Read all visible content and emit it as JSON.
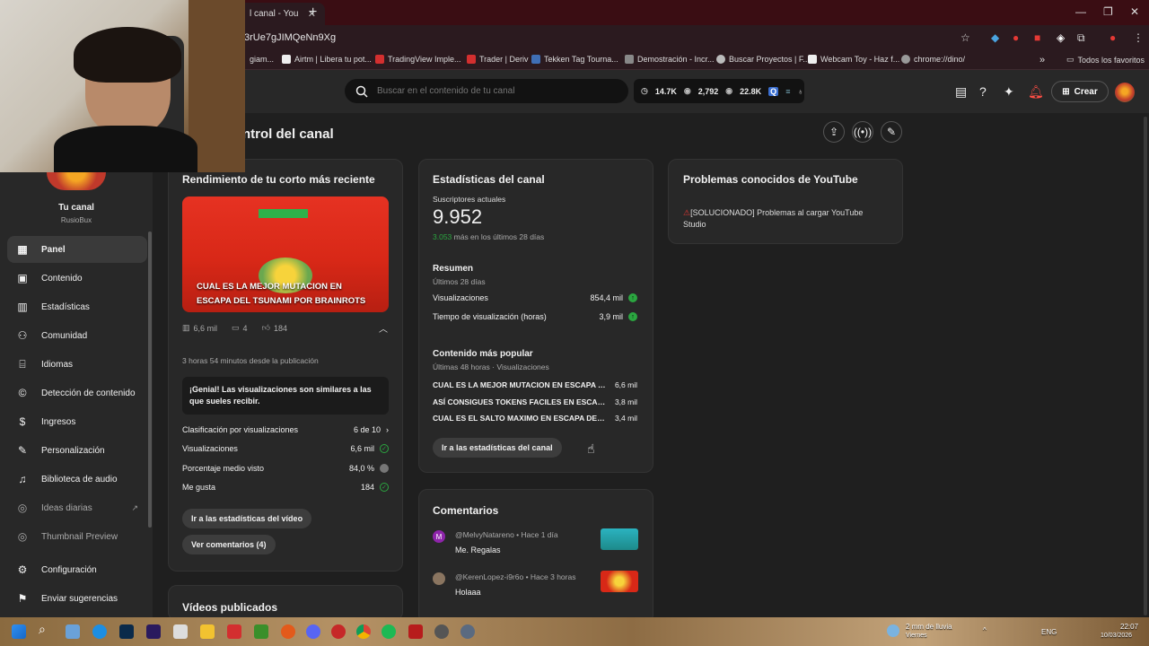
{
  "browser": {
    "tab_title": "l canal - You",
    "tab_close": "✕",
    "new_tab": "+",
    "url": "3rUe7gJIMQeNn9Xg",
    "bookmarks": [
      {
        "label": "giam..."
      },
      {
        "label": "Airtm | Libera tu pot..."
      },
      {
        "label": "TradingView Imple..."
      },
      {
        "label": "Trader | Deriv"
      },
      {
        "label": "Tekken Tag Tourna..."
      },
      {
        "label": "Demostración - Incr..."
      },
      {
        "label": "Buscar Proyectos | F..."
      },
      {
        "label": "Webcam Toy - Haz f..."
      },
      {
        "label": "chrome://dino/"
      }
    ],
    "all_bookmarks": "Todos los favoritos",
    "more_bookmarks": "»"
  },
  "header": {
    "search_placeholder": "Buscar en el contenido de tu canal",
    "stat1": "14.7K",
    "stat2": "2,792",
    "stat3": "22.8K",
    "create_label": "Crear"
  },
  "sidebar": {
    "channel_name": "Tu canal",
    "channel_handle": "RusioBux",
    "items": [
      {
        "label": "Panel"
      },
      {
        "label": "Contenido"
      },
      {
        "label": "Estadísticas"
      },
      {
        "label": "Comunidad"
      },
      {
        "label": "Idiomas"
      },
      {
        "label": "Detección de contenido"
      },
      {
        "label": "Ingresos"
      },
      {
        "label": "Personalización"
      },
      {
        "label": "Biblioteca de audio"
      },
      {
        "label": "Ideas diarias"
      },
      {
        "label": "Thumbnail Preview"
      },
      {
        "label": "Configuración"
      },
      {
        "label": "Enviar sugerencias"
      }
    ]
  },
  "page": {
    "title": "ntrol del canal"
  },
  "short_card": {
    "title": "Rendimiento de tu corto más reciente",
    "thumb_title": "CUAL ES LA MEJOR MUTACION EN ESCAPA DEL TSUNAMI POR BRAINROTS",
    "views": "6,6 mil",
    "comments": "4",
    "likes": "184",
    "time_since": "3 horas 54 minutos desde la publicación",
    "banner": "¡Genial! Las visualizaciones son similares a las que sueles recibir.",
    "rows": [
      {
        "label": "Clasificación por visualizaciones",
        "value": "6 de 10"
      },
      {
        "label": "Visualizaciones",
        "value": "6,6 mil"
      },
      {
        "label": "Porcentaje medio visto",
        "value": "84,0 %"
      },
      {
        "label": "Me gusta",
        "value": "184"
      }
    ],
    "btn_stats": "Ir a las estadísticas del vídeo",
    "btn_comments": "Ver comentarios (4)"
  },
  "published_card": {
    "title": "Vídeos publicados"
  },
  "channel_stats": {
    "title": "Estadísticas del canal",
    "subs_label": "Suscriptores actuales",
    "subs_value": "9.952",
    "subs_delta": "3.053",
    "subs_delta_text": " más en los últimos 28 días",
    "summary_title": "Resumen",
    "summary_sub": "Últimos 28 días",
    "views_label": "Visualizaciones",
    "views_value": "854,4 mil",
    "watch_label": "Tiempo de visualización (horas)",
    "watch_value": "3,9 mil",
    "popular_title": "Contenido más popular",
    "popular_sub": "Últimas 48 horas · Visualizaciones",
    "popular": [
      {
        "title": "CUAL ES LA MEJOR MUTACION EN ESCAPA DEL ...",
        "value": "6,6 mil"
      },
      {
        "title": "ASÍ CONSIGUES TOKENS FACILES EN ESCAPE DE...",
        "value": "3,8 mil"
      },
      {
        "title": "CUAL ES EL SALTO MAXIMO EN ESCAPA DEL TSU...",
        "value": "3,4 mil"
      }
    ],
    "btn": "Ir a las estadísticas del canal"
  },
  "comments_card": {
    "title": "Comentarios",
    "items": [
      {
        "avatar": "M",
        "author": "@MelvyNatareno",
        "time": "• Hace 1 día",
        "text": "Me. Regalas"
      },
      {
        "avatar": "",
        "author": "@KerenLopez-i9r6o",
        "time": "• Hace 3 horas",
        "text": "Holaaa"
      }
    ]
  },
  "problems_card": {
    "title": "Problemas conocidos de YouTube",
    "text": "[SOLUCIONADO] Problemas al cargar YouTube Studio"
  },
  "taskbar": {
    "weather": "2 mm de lluvia",
    "weather_day": "Viernes",
    "lang": "ENG",
    "time": "22:07",
    "date": "10/03/2026"
  }
}
